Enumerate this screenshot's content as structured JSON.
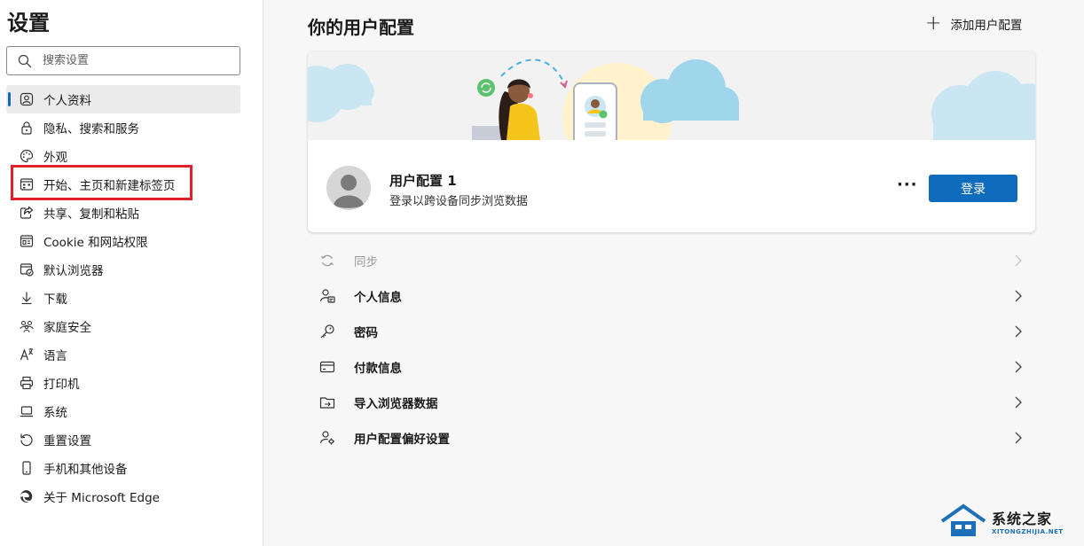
{
  "sidebar": {
    "title": "设置",
    "search_placeholder": "搜索设置",
    "items": [
      {
        "label": "个人资料",
        "icon": "profile-icon",
        "active": true
      },
      {
        "label": "隐私、搜索和服务",
        "icon": "lock-icon"
      },
      {
        "label": "外观",
        "icon": "palette-icon"
      },
      {
        "label": "开始、主页和新建标签页",
        "icon": "start-page-icon"
      },
      {
        "label": "共享、复制和粘贴",
        "icon": "share-icon"
      },
      {
        "label": "Cookie 和网站权限",
        "icon": "site-permissions-icon"
      },
      {
        "label": "默认浏览器",
        "icon": "default-browser-icon"
      },
      {
        "label": "下载",
        "icon": "download-icon"
      },
      {
        "label": "家庭安全",
        "icon": "family-icon"
      },
      {
        "label": "语言",
        "icon": "language-icon"
      },
      {
        "label": "打印机",
        "icon": "printer-icon"
      },
      {
        "label": "系统",
        "icon": "laptop-icon"
      },
      {
        "label": "重置设置",
        "icon": "reset-icon"
      },
      {
        "label": "手机和其他设备",
        "icon": "phone-icon"
      },
      {
        "label": "关于 Microsoft Edge",
        "icon": "edge-logo-icon"
      }
    ]
  },
  "main": {
    "title": "你的用户配置",
    "add_profile_label": "添加用户配置",
    "profile": {
      "name": "用户配置 1",
      "subtitle": "登录以跨设备同步浏览数据",
      "more_label": "···",
      "signin_label": "登录"
    },
    "rows": [
      {
        "label": "同步",
        "icon": "sync-icon",
        "disabled": true
      },
      {
        "label": "个人信息",
        "icon": "person-card-icon"
      },
      {
        "label": "密码",
        "icon": "key-icon"
      },
      {
        "label": "付款信息",
        "icon": "card-icon"
      },
      {
        "label": "导入浏览器数据",
        "icon": "import-icon"
      },
      {
        "label": "用户配置偏好设置",
        "icon": "profile-settings-icon"
      }
    ]
  },
  "watermark": {
    "main": "系统之家",
    "sub": "XITONGZHIJIA.NET"
  },
  "colors": {
    "accent": "#0f6cbd",
    "highlight": "#e0202a"
  }
}
